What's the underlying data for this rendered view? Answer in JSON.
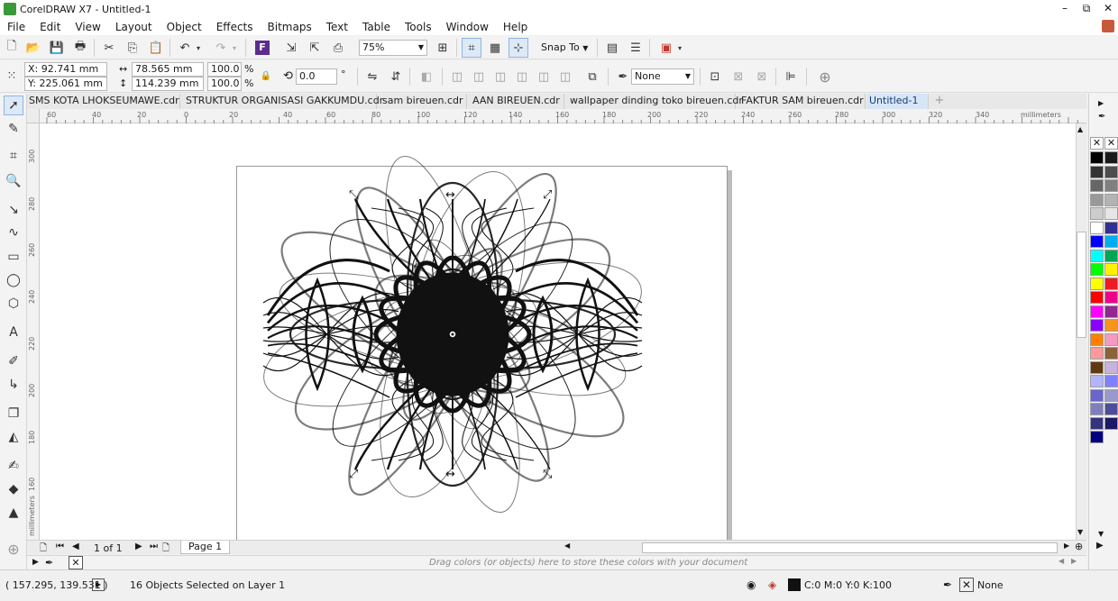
{
  "window": {
    "title": "CorelDRAW X7 - Untitled-1",
    "minimize": "–",
    "restore": "⧉",
    "close": "✕"
  },
  "menu": [
    "File",
    "Edit",
    "View",
    "Layout",
    "Object",
    "Effects",
    "Bitmaps",
    "Text",
    "Table",
    "Tools",
    "Window",
    "Help"
  ],
  "standard_toolbar": {
    "zoom_value": "75%",
    "snap_label": "Snap To"
  },
  "property_bar": {
    "x": "X: 92.741 mm",
    "y": "Y: 225.061 mm",
    "width": "78.565 mm",
    "height": "114.239 mm",
    "scale_w": "100.0",
    "scale_h": "100.0",
    "percent": "%",
    "rotation": "0.0",
    "degree": "°",
    "outline": "None"
  },
  "tabs": [
    {
      "label": "SMS KOTA LHOKSEUMAWE.cdr",
      "active": false
    },
    {
      "label": "STRUKTUR ORGANISASI GAKKUMDU.cdr",
      "active": false
    },
    {
      "label": "sam bireuen.cdr",
      "active": false
    },
    {
      "label": "AAN BIREUEN.cdr",
      "active": false
    },
    {
      "label": "wallpaper dinding toko bireuen.cdr",
      "active": false
    },
    {
      "label": "FAKTUR SAM bireuen.cdr",
      "active": false
    },
    {
      "label": "Untitled-1",
      "active": true
    }
  ],
  "add_tab": "+",
  "ruler": {
    "unit": "millimeters",
    "h_ticks": [
      "60",
      "40",
      "20",
      "0",
      "20",
      "40",
      "60",
      "80",
      "100",
      "120",
      "140",
      "160",
      "180",
      "200",
      "220",
      "240",
      "260",
      "280",
      "300",
      "320",
      "340"
    ],
    "v_ticks": [
      "300",
      "280",
      "260",
      "240",
      "220",
      "200",
      "180",
      "160"
    ]
  },
  "page_nav": {
    "count": "1 of 1",
    "page_tab": "Page 1"
  },
  "doc_palette_hint": "Drag colors (or objects) here to store these colors with your document",
  "status": {
    "cursor": "( 157.295, 139.531 )",
    "selection": "16 Objects Selected on Layer 1",
    "fill": "C:0 M:0 Y:0 K:100",
    "outline": "None"
  },
  "palette_colors": [
    "#000000",
    "#1a1a1a",
    "#333333",
    "#4d4d4d",
    "#666666",
    "#808080",
    "#999999",
    "#b3b3b3",
    "#cccccc",
    "#e6e6e6",
    "#ffffff",
    "#2e3192",
    "#0000ff",
    "#00aeef",
    "#00ffff",
    "#00a651",
    "#00ff00",
    "#fff200",
    "#ffff00",
    "#ed1c24",
    "#ff0000",
    "#ec008c",
    "#ff00ff",
    "#92278f",
    "#8b00ff",
    "#f7941d",
    "#ff7f00",
    "#f49ac2",
    "#ff9999",
    "#8c6239",
    "#603913",
    "#c7b2de",
    "#b3b3ff",
    "#8080ff",
    "#6666cc",
    "#9999cc",
    "#7f7fbf",
    "#4d4d99",
    "#333380",
    "#1a1a66",
    "#000080"
  ]
}
